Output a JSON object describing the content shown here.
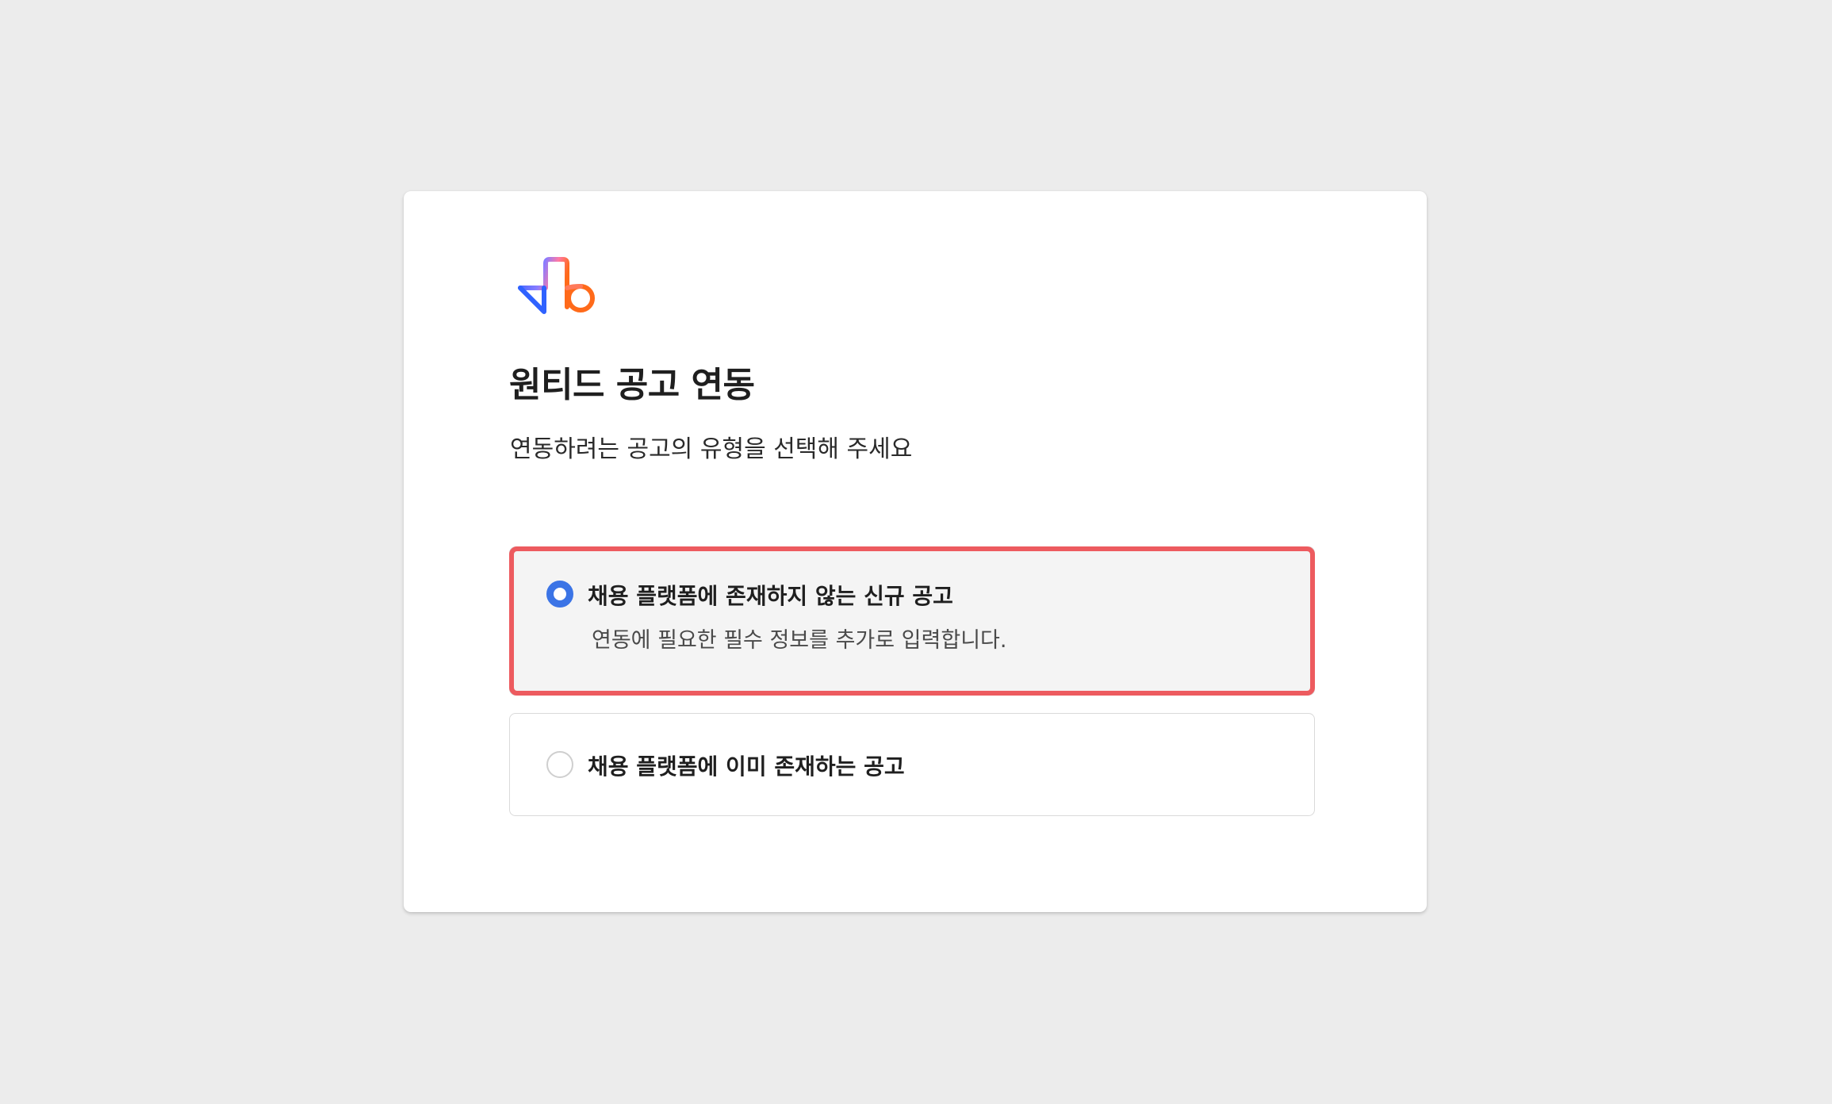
{
  "colors": {
    "background": "#ececec",
    "card": "#ffffff",
    "accent_blue": "#3b74e6",
    "highlight_red": "#ed5b5f",
    "selected_option_bg": "#f4f4f4"
  },
  "logo": {
    "icon": "wanted-logo-icon"
  },
  "dialog": {
    "title": "원티드 공고 연동",
    "subtitle": "연동하려는 공고의 유형을 선택해 주세요"
  },
  "options": [
    {
      "label": "채용 플랫폼에 존재하지 않는 신규 공고",
      "description": "연동에 필요한 필수 정보를 추가로 입력합니다.",
      "selected": true
    },
    {
      "label": "채용 플랫폼에 이미 존재하는 공고",
      "selected": false
    }
  ]
}
